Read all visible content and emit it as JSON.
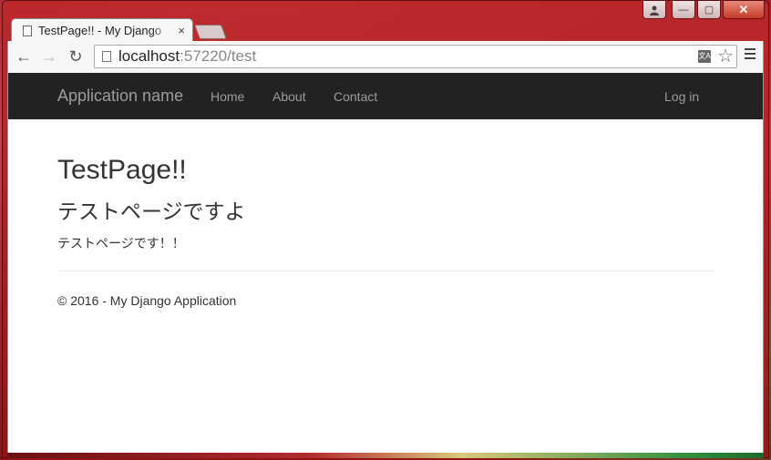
{
  "browser": {
    "tab_title": "TestPage!! - My Django",
    "tab_close_glyph": "×",
    "url_host": "localhost",
    "url_rest": ":57220/test",
    "caption_close_glyph": "✕",
    "caption_min_glyph": "—",
    "caption_max_glyph": "▢",
    "translate_glyph": "文A",
    "star_glyph": "☆",
    "back_glyph": "←",
    "forward_glyph": "→",
    "reload_glyph": "↻"
  },
  "navbar": {
    "brand": "Application name",
    "links": [
      "Home",
      "About",
      "Contact"
    ],
    "login": "Log in",
    "background": "#222222",
    "link_color": "#9d9d9d"
  },
  "content": {
    "title": "TestPage!!",
    "subtitle": "テストページですよ",
    "text": "テストページです！！"
  },
  "footer": {
    "text": "© 2016 - My Django Application"
  }
}
